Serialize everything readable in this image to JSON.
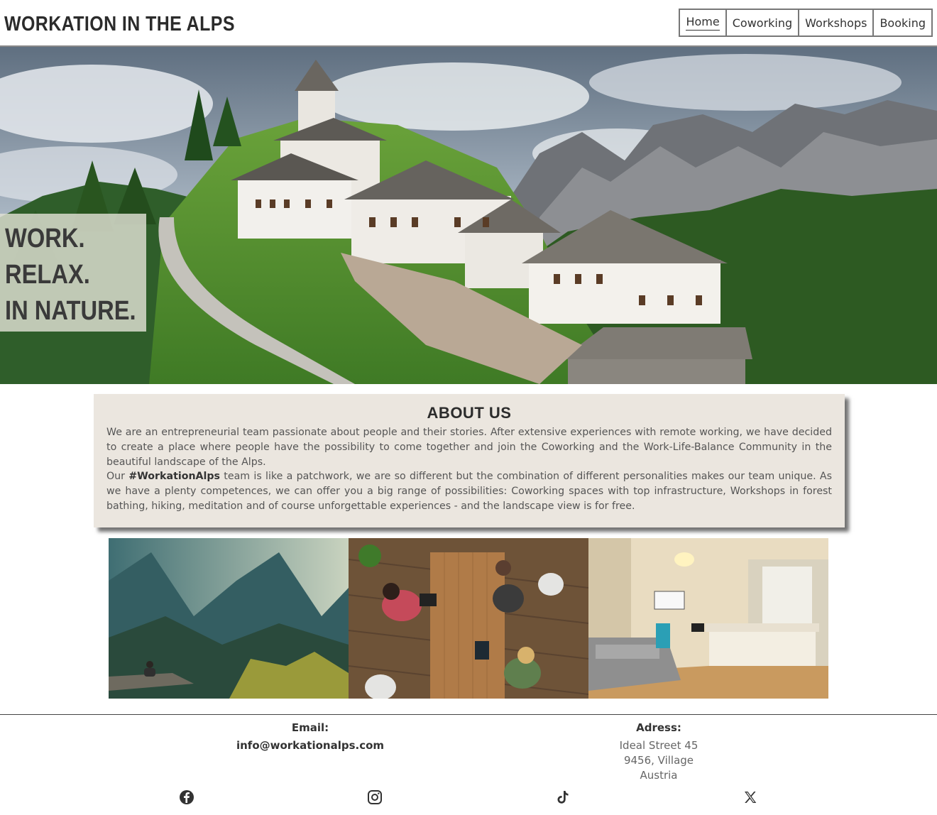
{
  "header": {
    "brand": "WORKATION IN THE ALPS",
    "nav": [
      {
        "label": "Home",
        "active": true
      },
      {
        "label": "Coworking",
        "active": false
      },
      {
        "label": "Workshops",
        "active": false
      },
      {
        "label": "Booking",
        "active": false
      }
    ]
  },
  "hero": {
    "lines": [
      "WORK.",
      "RELAX.",
      "IN NATURE."
    ]
  },
  "about": {
    "title": "ABOUT US",
    "p1": "We are an entrepreneurial team passionate about people and their stories. After extensive experiences with remote working, we have decided to create a place where people have the possibility to come together and join the Coworking and the Work-Life-Balance Community in the beautiful landscape of the Alps.",
    "p2_before": "Our ",
    "p2_hashtag": "#WorkationAlps",
    "p2_after": " team is like a patchwork, we are so different but the combination of different personalities makes our team unique. As we have a plenty competences, we can offer you a big range of possibilities: Coworking spaces with top infrastructure, Workshops in forest bathing, hiking, meditation and of course unforgettable experiences - and the landscape view is for free."
  },
  "footer": {
    "email_label": "Email:",
    "email": "info@workationalps.com",
    "address_label": "Adress:",
    "address_lines": [
      "Ideal Street 45",
      "9456, Village",
      "Austria"
    ],
    "social": [
      "facebook-icon",
      "instagram-icon",
      "tiktok-icon",
      "x-icon"
    ]
  },
  "colors": {
    "about_bg": "#ebe6df",
    "tagline_bg": "#e1e1d4",
    "text_dark": "#2b2b2b"
  }
}
